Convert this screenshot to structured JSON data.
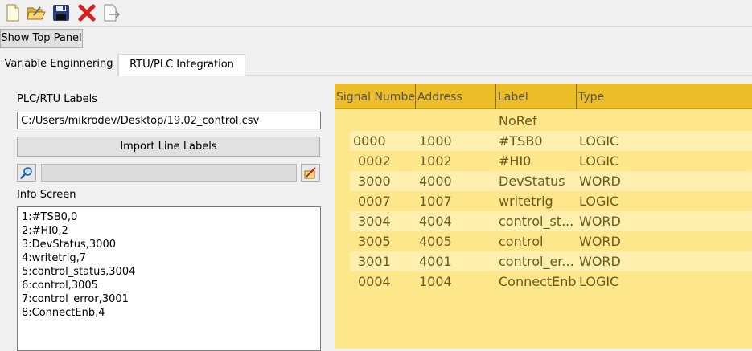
{
  "toolbar": {
    "icons": [
      "new-file-icon",
      "open-folder-icon",
      "save-icon",
      "delete-icon",
      "export-icon"
    ]
  },
  "show_top_panel_label": "Show Top Panel",
  "tabs": [
    {
      "label": "Variable Enginnering",
      "active": false
    },
    {
      "label": "RTU/PLC Integration",
      "active": true
    }
  ],
  "left": {
    "labels_title": "PLC/RTU Labels",
    "path_value": "C:/Users/mikrodev/Desktop/19.02_control.csv",
    "import_label": "Import Line Labels",
    "info_title": "Info Screen",
    "info_lines": [
      "1:#TSB0,0",
      "2:#HI0,2",
      "3:DevStatus,3000",
      "4:writetrig,7",
      "5:control_status,3004",
      "6:control,3005",
      "7:control_error,3001",
      "8:ConnectEnb,4"
    ]
  },
  "grid": {
    "columns": [
      "Signal Number",
      "Address",
      "Label",
      "Type"
    ],
    "rows": [
      {
        "signal": "",
        "address": "",
        "label": "NoRef",
        "type": ""
      },
      {
        "signal": "0000",
        "address": "1000",
        "label": "#TSB0",
        "type": "LOGIC"
      },
      {
        "signal": "0002",
        "address": "1002",
        "label": "#HI0",
        "type": "LOGIC"
      },
      {
        "signal": "3000",
        "address": "4000",
        "label": "DevStatus",
        "type": "WORD"
      },
      {
        "signal": "0007",
        "address": "1007",
        "label": "writetrig",
        "type": "LOGIC"
      },
      {
        "signal": "3004",
        "address": "4004",
        "label": "control_st...",
        "type": "WORD"
      },
      {
        "signal": "3005",
        "address": "4005",
        "label": "control",
        "type": "WORD"
      },
      {
        "signal": "3001",
        "address": "4001",
        "label": "control_er...",
        "type": "WORD"
      },
      {
        "signal": "0004",
        "address": "1004",
        "label": "ConnectEnb",
        "type": "LOGIC"
      }
    ]
  }
}
